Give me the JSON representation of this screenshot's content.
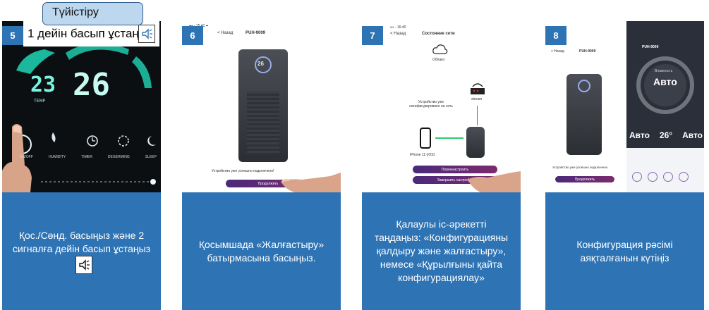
{
  "step5": {
    "num": "5",
    "callout": "Түйістіру",
    "overlay_text": "1 дейін басып ұстаңыз",
    "screen_labels": [
      "ON/OFF",
      "HUMIDITY",
      "TIMER",
      "DEGERMING",
      "SLEEP"
    ],
    "temp_label": "TEMP",
    "caption": "Қос./Сөнд. басыңыз және 2 сигналға дейін басып ұстаңыз"
  },
  "step6": {
    "num": "6",
    "nav_back": "< Назад",
    "model": "PUH-9009",
    "device_display": "26",
    "status_text": "Устройство уже успешно подключено!",
    "button": "Продолжить",
    "caption": "Қосымшада «Жалғастыру» батырмасына басыңыз."
  },
  "step7": {
    "num": "7",
    "nav_back": "< Назад",
    "title": "Состояние сети",
    "cloud_label": "Облако",
    "router_label": "stream",
    "configured_text": "Устройство уже сконфигурировано на сеть",
    "phone_label": "iPhone 11 (iOS)",
    "button_reconfigure": "Переннастроить",
    "button_finish": "Завершить настройку",
    "caption": "Қалаулы іс-әрекетті таңдаңыз: «Конфигурацияны қалдыру және жалғастыру», немесе «Құрылғыны қайта конфигурациялау»"
  },
  "step8": {
    "num": "8",
    "nav_back": "< Назад",
    "model": "PUH-9009",
    "right_title": "PUH-9009",
    "mode_label": "Влажность",
    "mode_value": "Авто",
    "stat_values": [
      "Авто",
      "26°",
      "Авто"
    ],
    "status_text": "Устройство уже успешно подключено",
    "button": "Продолжить",
    "caption": "Конфигурация рәсімі аяқталғанын күтіңіз"
  },
  "colors": {
    "panel_blue": "#2e74b5",
    "callout_bg": "#bdd7ee",
    "accent_purple": "#6d3a8a"
  },
  "icons": [
    "speaker-icon",
    "power-icon",
    "humidity-icon",
    "timer-icon",
    "degerming-icon",
    "sleep-icon",
    "cloud-icon",
    "router-icon",
    "phone-icon"
  ]
}
